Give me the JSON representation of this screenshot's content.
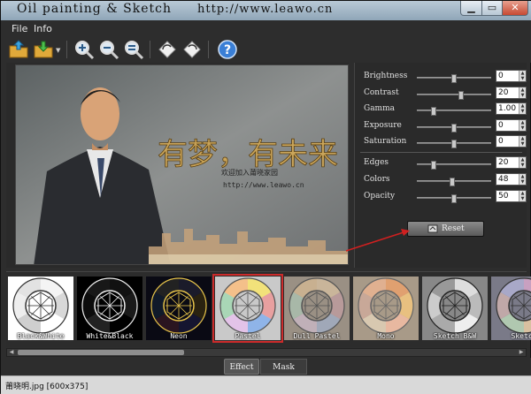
{
  "window": {
    "app_title": "Oil painting & Sketch",
    "url": "http://www.leawo.cn"
  },
  "menu": [
    "File",
    "Info"
  ],
  "toolbar": {
    "icons": [
      "open-folder-icon",
      "save-icon",
      "zoom-in-icon",
      "zoom-out-icon",
      "zoom-fit-icon",
      "rotate-left-icon",
      "rotate-right-icon",
      "help-icon"
    ]
  },
  "adjustments": [
    {
      "label": "Brightness",
      "value": "0",
      "level": 0.5
    },
    {
      "label": "Contrast",
      "value": "20",
      "level": 0.6
    },
    {
      "label": "Gamma",
      "value": "1.00",
      "level": 0.2
    },
    {
      "label": "Exposure",
      "value": "0",
      "level": 0.5
    },
    {
      "label": "Saturation",
      "value": "0",
      "level": 0.5
    }
  ],
  "effect_settings": [
    {
      "label": "Edges",
      "value": "20",
      "level": 0.2
    },
    {
      "label": "Colors",
      "value": "48",
      "level": 0.48
    },
    {
      "label": "Opacity",
      "value": "50",
      "level": 0.5
    }
  ],
  "reset_label": "Reset",
  "effects": [
    {
      "label": "Black&White",
      "theme": "bw"
    },
    {
      "label": "White&Black",
      "theme": "wb"
    },
    {
      "label": "Neon",
      "theme": "neon"
    },
    {
      "label": "Pastel",
      "theme": "pastel",
      "selected": true
    },
    {
      "label": "Dull Pastel",
      "theme": "dull"
    },
    {
      "label": "Mono",
      "theme": "mono"
    },
    {
      "label": "Sketch B&W",
      "theme": "sketch"
    },
    {
      "label": "Sketch",
      "theme": "sketch2"
    }
  ],
  "tabs": [
    "Effect",
    "Mask"
  ],
  "status": "莆晓明.jpg [600x375]",
  "photo_text": {
    "calligraphy": "有梦，有未来",
    "subline": "欢迎加入莆晓家园",
    "url": "http://www.leawo.cn"
  }
}
